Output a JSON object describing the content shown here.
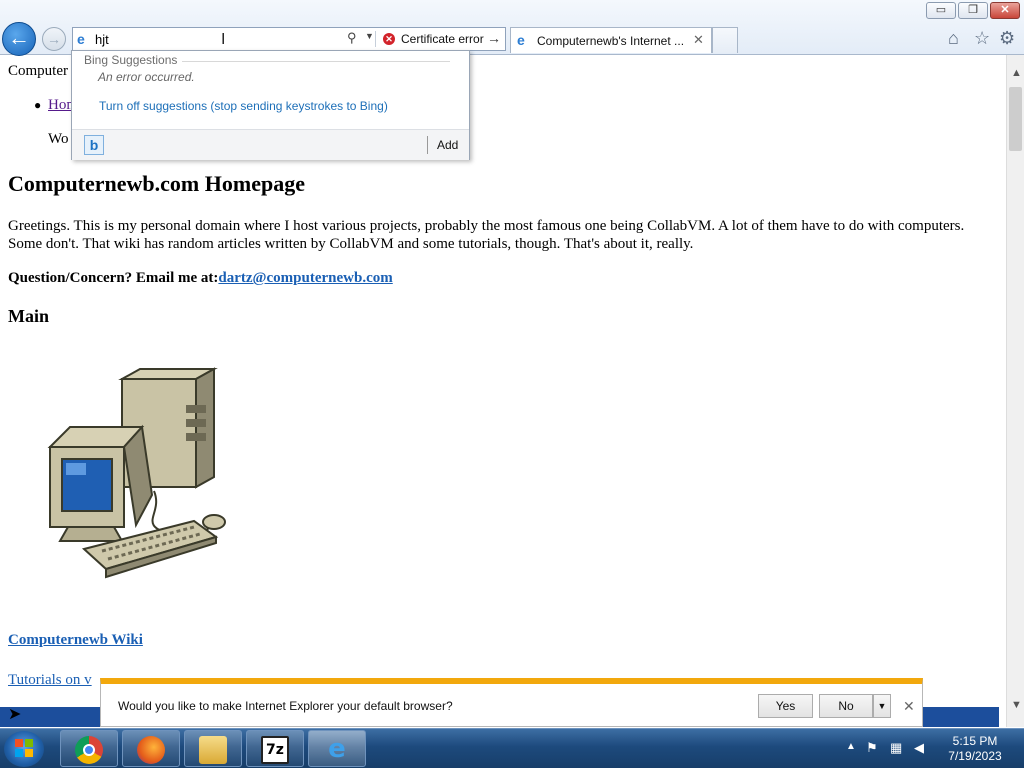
{
  "window": {
    "minimize": "▭",
    "maximize": "❐",
    "close": "✕"
  },
  "nav": {
    "back": "←",
    "forward": "→"
  },
  "address": {
    "value": "hjt",
    "cert_error": "Certificate error"
  },
  "tabs": [
    {
      "title": "Computernewb's Internet ..."
    }
  ],
  "suggestions": {
    "title": "Bing Suggestions",
    "error": "An error occurred.",
    "turn_off": "Turn off suggestions (stop sending keystrokes to Bing)",
    "provider_icon": "b",
    "add": "Add"
  },
  "page": {
    "breadcrumb": "Computer",
    "nav_home": "Hom",
    "welcome": "Wo",
    "heading": "Computernewb.com Homepage",
    "intro": "Greetings. This is my personal domain where I host various projects, probably the most famous one being CollabVM. A lot of them have to do with computers. Some don't. That wiki has random articles written by CollabVM and some tutorials, though. That's about it, really.",
    "contact_label": "Question/Concern? Email me at:",
    "contact_email": "dartz@computernewb.com",
    "main_heading": "Main",
    "wiki_link": "Computernewb Wiki",
    "tutorials_link": "Tutorials on v"
  },
  "notification": {
    "text": "Would you like to make Internet Explorer your default browser?",
    "yes": "Yes",
    "no": "No"
  },
  "taskbar": {
    "apps": [
      "chrome-icon",
      "firefox-icon",
      "file-explorer-icon",
      "7zip-icon",
      "internet-explorer-icon"
    ],
    "seven_zip_label": "7z",
    "ie_label": "e",
    "time": "5:15 PM",
    "date": "7/19/2023"
  },
  "colors": {
    "link": "#1a5fb4",
    "visited": "#551a8b",
    "notification_accent": "#f2a80d",
    "cert_error": "#d2232a"
  }
}
